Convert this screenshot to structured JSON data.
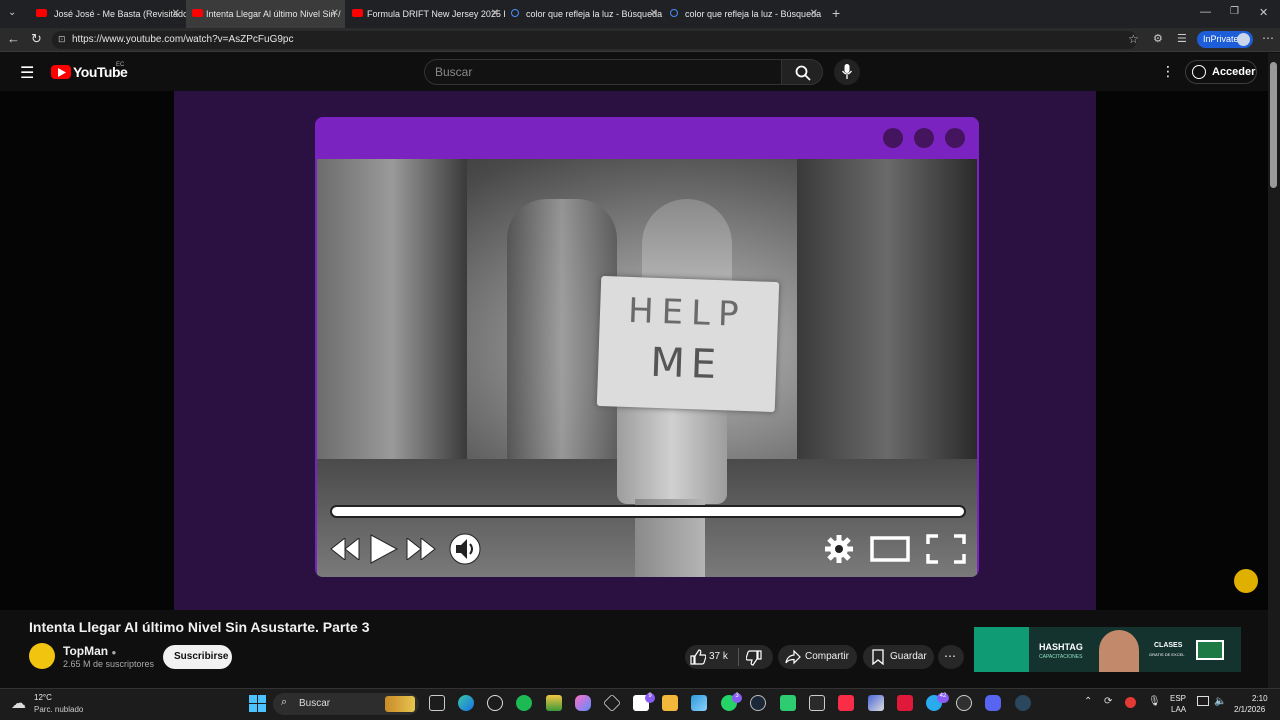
{
  "browser": {
    "tabs": [
      {
        "title": "José José - Me Basta (Revisitado [I",
        "icon": "youtube-icon"
      },
      {
        "title": "Intenta Llegar Al último Nivel Sin /",
        "icon": "youtube-icon",
        "active": true
      },
      {
        "title": "Formula DRIFT New Jersey 2025 H",
        "icon": "youtube-icon"
      },
      {
        "title": "color que refleja la luz - Búsqueda",
        "icon": "search-icon"
      },
      {
        "title": "color que refleja la luz - Búsqueda",
        "icon": "search-icon"
      }
    ],
    "url": "https://www.youtube.com/watch?v=AsZPcFuG9pc",
    "inprivate_label": "InPrivate"
  },
  "youtube": {
    "logo": "YouTube",
    "region": "EC",
    "search_placeholder": "Buscar",
    "signin_label": "Acceder"
  },
  "video": {
    "sign_line1": "HELP",
    "sign_line2": "ME",
    "title": "Intenta Llegar Al último Nivel Sin Asustarte. Parte 3",
    "channel": "TopMan",
    "subscribers": "2.65 M de suscriptores",
    "subscribe_label": "Suscribirse",
    "likes": "37 k",
    "share_label": "Compartir",
    "save_label": "Guardar"
  },
  "ad": {
    "line1": "HASHTAG",
    "line2": "CAPACITACIONES",
    "line3": "CLASES",
    "line4": "GRATIS DE EXCEL"
  },
  "taskbar": {
    "temp": "12°C",
    "weather": "Parc. nublado",
    "search_label": "Buscar",
    "lang1": "ESP",
    "lang2": "LAA",
    "time": "2:10",
    "date": "2/1/2026",
    "badge1": "9",
    "badge2": "3",
    "badge3": "42"
  },
  "colors": {
    "accent_purple": "#7b23c0",
    "youtube_red": "#ff0000",
    "inprivate_blue": "#1e5dd8"
  }
}
